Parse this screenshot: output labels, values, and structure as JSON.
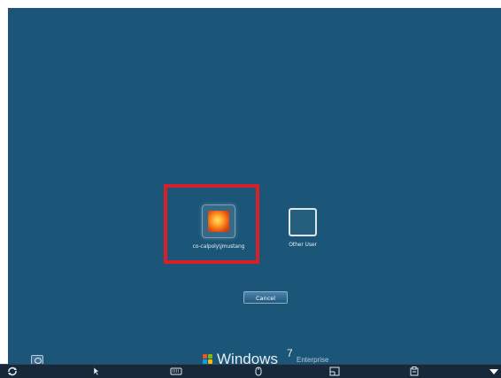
{
  "login_screen": {
    "user_tile": {
      "username": "co-calpoly\\jmustang",
      "avatar_icon": "flower-avatar-icon"
    },
    "other_tile": {
      "label": "Other User",
      "icon": "blank-user-icon"
    },
    "cancel_label": "Cancel",
    "ease_of_access_icon": "ease-of-access-icon",
    "highlight_color": "#d8202a"
  },
  "branding": {
    "name": "Windows",
    "version": "7",
    "edition": "Enterprise",
    "logo_icon": "windows-logo-icon"
  },
  "toolbar": {
    "items": [
      {
        "icon": "circular-arrows-icon"
      },
      {
        "icon": "pointer-icon"
      },
      {
        "icon": "keyboard-icon"
      },
      {
        "icon": "mouse-icon"
      },
      {
        "icon": "window-icon"
      },
      {
        "icon": "clipboard-icon"
      },
      {
        "icon": "triangle-down-icon"
      }
    ]
  },
  "colors": {
    "background": "#1b5678",
    "toolbar": "#17283a"
  }
}
